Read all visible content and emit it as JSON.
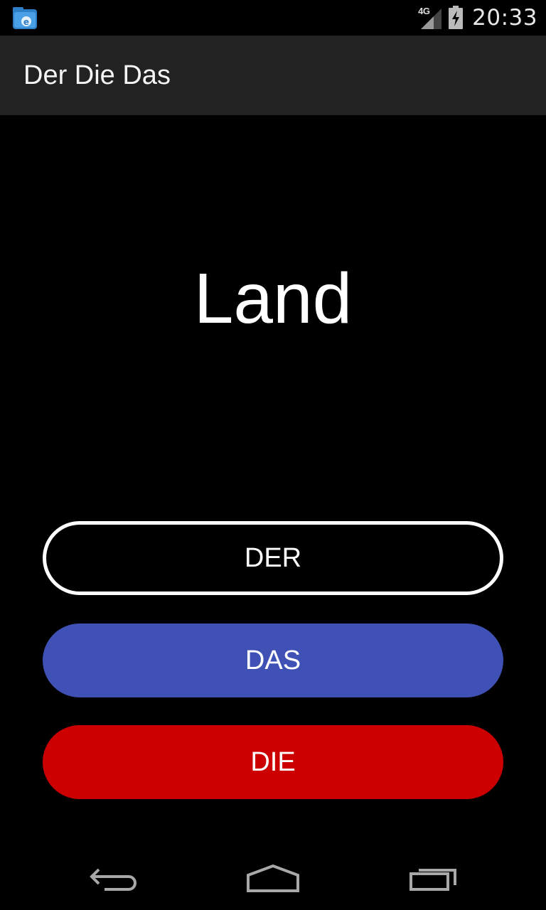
{
  "status_bar": {
    "network_type": "4G",
    "time": "20:33",
    "icons": {
      "notification": "file-manager-app-icon",
      "signal": "cell-signal-icon",
      "battery": "battery-charging-icon"
    }
  },
  "action_bar": {
    "title": "Der Die Das"
  },
  "quiz": {
    "word": "Land"
  },
  "answers": {
    "der": "DER",
    "das": "DAS",
    "die": "DIE"
  },
  "colors": {
    "action_bar_bg": "#222222",
    "der_outline": "#ffffff",
    "das_bg": "#3f51b5",
    "die_bg": "#cc0000"
  },
  "nav_bar": {
    "icons": [
      "back-icon",
      "home-icon",
      "recents-icon"
    ]
  }
}
